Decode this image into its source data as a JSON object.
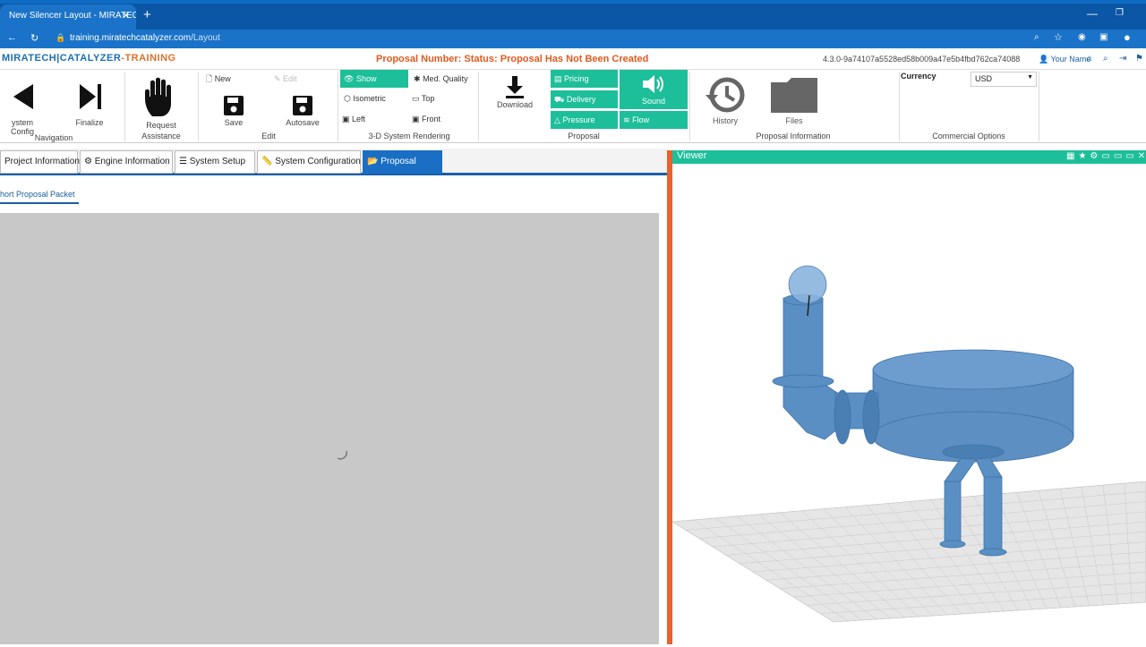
{
  "browser": {
    "tab_title": "New Silencer Layout - MIRATECH",
    "tab_close": "✕",
    "new_tab": "+",
    "url_domain": "training.miratechcatalyzer.com",
    "url_path": "/Layout"
  },
  "header": {
    "logo_main": "MIRATECH|CATALYZER",
    "logo_suffix": "-TRAINING",
    "proposal_status": "Proposal Number: Status: Proposal Has Not Been Created",
    "version": "4.3.0-9a74107a5528ed58b009a47e5b4fbd762ca74088",
    "user": "Your Name"
  },
  "ribbon": {
    "navigation": {
      "label": "Navigation",
      "system_config": "ystem Config",
      "finalize": "Finalize"
    },
    "assistance": {
      "label": "Request\nAssistance"
    },
    "edit": {
      "label": "Edit",
      "new": "New",
      "edit": "Edit",
      "save": "Save",
      "autosave": "Autosave"
    },
    "rendering": {
      "label": "3-D System Rendering",
      "show": "Show",
      "med_quality": "Med. Quality",
      "isometric": "Isometric",
      "top": "Top",
      "left": "Left",
      "front": "Front"
    },
    "download": {
      "label": "Download"
    },
    "proposal": {
      "label": "Proposal",
      "pricing": "Pricing",
      "delivery": "Delivery",
      "pressure": "Pressure",
      "sound": "Sound",
      "flow": "Flow"
    },
    "info": {
      "label": "Proposal Information",
      "history": "History",
      "files": "Files"
    },
    "commercial": {
      "label": "Commercial Options",
      "currency_label": "Currency",
      "currency_value": "USD"
    }
  },
  "tabs": [
    {
      "label": "Project Information"
    },
    {
      "label": "Engine Information"
    },
    {
      "label": "System Setup"
    },
    {
      "label": "System Configuration"
    },
    {
      "label": "Proposal"
    }
  ],
  "subtab": "hort Proposal Packet",
  "viewer": {
    "title": "Viewer"
  },
  "colors": {
    "accent_green": "#1dbf9a",
    "brand_blue": "#1a6fc4",
    "splitter_orange": "#e8622c",
    "status_orange": "#e05a1e"
  }
}
